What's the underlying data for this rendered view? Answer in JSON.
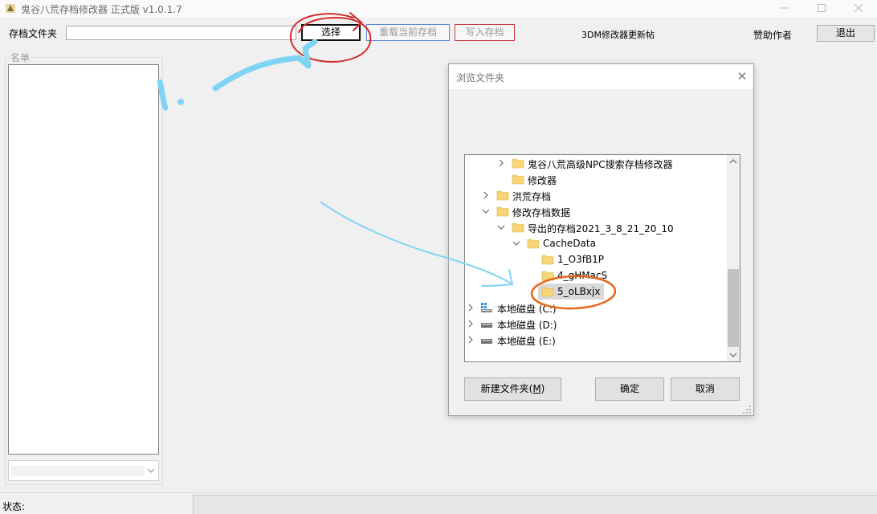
{
  "window": {
    "title": "鬼谷八荒存档修改器 正式版 v1.0.1.7"
  },
  "toolbar": {
    "folder_label": "存档文件夹",
    "folder_path": "",
    "select_label": "选择",
    "reload_label": "重载当前存档",
    "write_label": "写入存档",
    "forum_link": "3DM修改器更新帖",
    "sponsor_label": "赞助作者",
    "exit_label": "退出"
  },
  "left_panel": {
    "group_label": "名单",
    "combo_value": ""
  },
  "status": {
    "label": "状态:",
    "value": ""
  },
  "dialog": {
    "title": "浏览文件夹",
    "close_glyph": "✕",
    "tree": [
      {
        "label": "鬼谷八荒高级NPC搜索存档修改器",
        "icon": "folder-icon"
      },
      {
        "label": "修改器",
        "icon": "folder-icon"
      },
      {
        "label": "洪荒存档",
        "icon": "folder-icon"
      },
      {
        "label": "修改存档数据",
        "icon": "folder-icon"
      },
      {
        "label": "导出的存档2021_3_8_21_20_10",
        "icon": "folder-icon"
      },
      {
        "label": "CacheData",
        "icon": "folder-icon"
      },
      {
        "label": "1_O3fB1P",
        "icon": "folder-icon"
      },
      {
        "label": "4_gHMacS",
        "icon": "folder-icon"
      },
      {
        "label": "5_oLBxjx",
        "icon": "folder-icon"
      },
      {
        "label": "本地磁盘 (C:)",
        "icon": "windows-drive-icon"
      },
      {
        "label": "本地磁盘 (D:)",
        "icon": "drive-icon"
      },
      {
        "label": "本地磁盘 (E:)",
        "icon": "drive-icon"
      }
    ],
    "new_folder_label": "新建文件夹(",
    "new_folder_mnemonic": "M",
    "new_folder_suffix": ")",
    "ok_label": "确定",
    "cancel_label": "取消"
  },
  "colors": {
    "annotation_red": "#d42a2a",
    "annotation_blue": "#7fd4f5",
    "annotation_orange": "#e8681a",
    "folder_yellow": "#f6d677"
  }
}
